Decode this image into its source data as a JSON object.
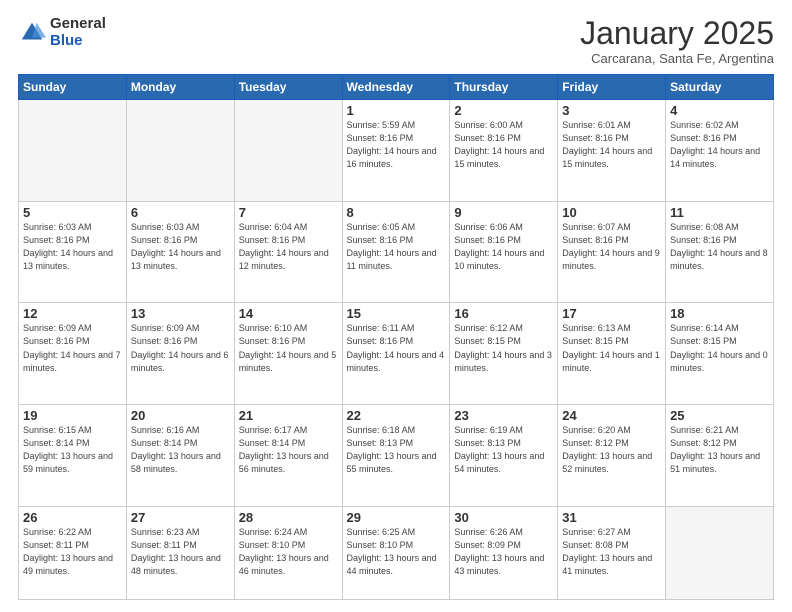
{
  "logo": {
    "general": "General",
    "blue": "Blue"
  },
  "header": {
    "month": "January 2025",
    "location": "Carcarana, Santa Fe, Argentina"
  },
  "weekdays": [
    "Sunday",
    "Monday",
    "Tuesday",
    "Wednesday",
    "Thursday",
    "Friday",
    "Saturday"
  ],
  "weeks": [
    [
      {
        "day": "",
        "info": ""
      },
      {
        "day": "",
        "info": ""
      },
      {
        "day": "",
        "info": ""
      },
      {
        "day": "1",
        "info": "Sunrise: 5:59 AM\nSunset: 8:16 PM\nDaylight: 14 hours and 16 minutes."
      },
      {
        "day": "2",
        "info": "Sunrise: 6:00 AM\nSunset: 8:16 PM\nDaylight: 14 hours and 15 minutes."
      },
      {
        "day": "3",
        "info": "Sunrise: 6:01 AM\nSunset: 8:16 PM\nDaylight: 14 hours and 15 minutes."
      },
      {
        "day": "4",
        "info": "Sunrise: 6:02 AM\nSunset: 8:16 PM\nDaylight: 14 hours and 14 minutes."
      }
    ],
    [
      {
        "day": "5",
        "info": "Sunrise: 6:03 AM\nSunset: 8:16 PM\nDaylight: 14 hours and 13 minutes."
      },
      {
        "day": "6",
        "info": "Sunrise: 6:03 AM\nSunset: 8:16 PM\nDaylight: 14 hours and 13 minutes."
      },
      {
        "day": "7",
        "info": "Sunrise: 6:04 AM\nSunset: 8:16 PM\nDaylight: 14 hours and 12 minutes."
      },
      {
        "day": "8",
        "info": "Sunrise: 6:05 AM\nSunset: 8:16 PM\nDaylight: 14 hours and 11 minutes."
      },
      {
        "day": "9",
        "info": "Sunrise: 6:06 AM\nSunset: 8:16 PM\nDaylight: 14 hours and 10 minutes."
      },
      {
        "day": "10",
        "info": "Sunrise: 6:07 AM\nSunset: 8:16 PM\nDaylight: 14 hours and 9 minutes."
      },
      {
        "day": "11",
        "info": "Sunrise: 6:08 AM\nSunset: 8:16 PM\nDaylight: 14 hours and 8 minutes."
      }
    ],
    [
      {
        "day": "12",
        "info": "Sunrise: 6:09 AM\nSunset: 8:16 PM\nDaylight: 14 hours and 7 minutes."
      },
      {
        "day": "13",
        "info": "Sunrise: 6:09 AM\nSunset: 8:16 PM\nDaylight: 14 hours and 6 minutes."
      },
      {
        "day": "14",
        "info": "Sunrise: 6:10 AM\nSunset: 8:16 PM\nDaylight: 14 hours and 5 minutes."
      },
      {
        "day": "15",
        "info": "Sunrise: 6:11 AM\nSunset: 8:16 PM\nDaylight: 14 hours and 4 minutes."
      },
      {
        "day": "16",
        "info": "Sunrise: 6:12 AM\nSunset: 8:15 PM\nDaylight: 14 hours and 3 minutes."
      },
      {
        "day": "17",
        "info": "Sunrise: 6:13 AM\nSunset: 8:15 PM\nDaylight: 14 hours and 1 minute."
      },
      {
        "day": "18",
        "info": "Sunrise: 6:14 AM\nSunset: 8:15 PM\nDaylight: 14 hours and 0 minutes."
      }
    ],
    [
      {
        "day": "19",
        "info": "Sunrise: 6:15 AM\nSunset: 8:14 PM\nDaylight: 13 hours and 59 minutes."
      },
      {
        "day": "20",
        "info": "Sunrise: 6:16 AM\nSunset: 8:14 PM\nDaylight: 13 hours and 58 minutes."
      },
      {
        "day": "21",
        "info": "Sunrise: 6:17 AM\nSunset: 8:14 PM\nDaylight: 13 hours and 56 minutes."
      },
      {
        "day": "22",
        "info": "Sunrise: 6:18 AM\nSunset: 8:13 PM\nDaylight: 13 hours and 55 minutes."
      },
      {
        "day": "23",
        "info": "Sunrise: 6:19 AM\nSunset: 8:13 PM\nDaylight: 13 hours and 54 minutes."
      },
      {
        "day": "24",
        "info": "Sunrise: 6:20 AM\nSunset: 8:12 PM\nDaylight: 13 hours and 52 minutes."
      },
      {
        "day": "25",
        "info": "Sunrise: 6:21 AM\nSunset: 8:12 PM\nDaylight: 13 hours and 51 minutes."
      }
    ],
    [
      {
        "day": "26",
        "info": "Sunrise: 6:22 AM\nSunset: 8:11 PM\nDaylight: 13 hours and 49 minutes."
      },
      {
        "day": "27",
        "info": "Sunrise: 6:23 AM\nSunset: 8:11 PM\nDaylight: 13 hours and 48 minutes."
      },
      {
        "day": "28",
        "info": "Sunrise: 6:24 AM\nSunset: 8:10 PM\nDaylight: 13 hours and 46 minutes."
      },
      {
        "day": "29",
        "info": "Sunrise: 6:25 AM\nSunset: 8:10 PM\nDaylight: 13 hours and 44 minutes."
      },
      {
        "day": "30",
        "info": "Sunrise: 6:26 AM\nSunset: 8:09 PM\nDaylight: 13 hours and 43 minutes."
      },
      {
        "day": "31",
        "info": "Sunrise: 6:27 AM\nSunset: 8:08 PM\nDaylight: 13 hours and 41 minutes."
      },
      {
        "day": "",
        "info": ""
      }
    ]
  ]
}
